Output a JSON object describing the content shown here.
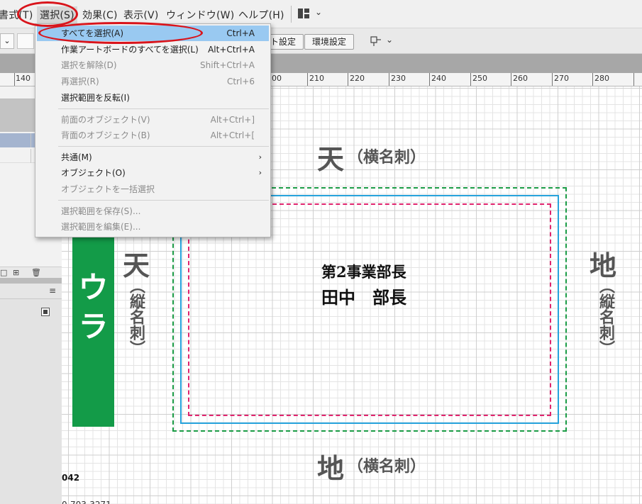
{
  "menubar": {
    "items": [
      "書式(T)",
      "選択(S)",
      "効果(C)",
      "表示(V)",
      "ウィンドウ(W)",
      "ヘルプ(H)"
    ]
  },
  "controlbar": {
    "doc_setup_button": "ト設定",
    "preferences_button": "環境設定"
  },
  "ruler": {
    "labels": [
      "140",
      "00",
      "210",
      "220",
      "230",
      "240",
      "250",
      "260",
      "270",
      "280"
    ]
  },
  "canvas": {
    "top_char": "天",
    "top_label": "（横名刺）",
    "bottom_char": "地",
    "bottom_label": "（横名刺）",
    "left_char": "天",
    "left_label": "（縦名刺）",
    "right_char": "地",
    "right_label": "（縦名刺）",
    "green_bar_text": [
      "ウ",
      "ラ"
    ],
    "card_title": "第2事業部長",
    "card_name": "田中　部長",
    "footer_number": "042",
    "footer_partial": "0-703-3271",
    "colors": {
      "bleed_guide": "#1b9c46",
      "trim_line": "#27a3dc",
      "safe_area": "#e0246e",
      "green_bar": "#139b48"
    }
  },
  "dropdown": {
    "items": [
      {
        "label": "すべてを選択(A)",
        "shortcut": "Ctrl+A",
        "disabled": false,
        "highlight": true
      },
      {
        "label": "作業アートボードのすべてを選択(L)",
        "shortcut": "Alt+Ctrl+A",
        "disabled": false
      },
      {
        "label": "選択を解除(D)",
        "shortcut": "Shift+Ctrl+A",
        "disabled": true
      },
      {
        "label": "再選択(R)",
        "shortcut": "Ctrl+6",
        "disabled": true
      },
      {
        "label": "選択範囲を反転(I)",
        "shortcut": "",
        "disabled": false
      },
      {
        "label": "前面のオブジェクト(V)",
        "shortcut": "Alt+Ctrl+]",
        "disabled": true
      },
      {
        "label": "背面のオブジェクト(B)",
        "shortcut": "Alt+Ctrl+[",
        "disabled": true
      },
      {
        "label": "共通(M)",
        "shortcut": "",
        "disabled": false,
        "submenu": true
      },
      {
        "label": "オブジェクト(O)",
        "shortcut": "",
        "disabled": false,
        "submenu": true
      },
      {
        "label": "オブジェクトを一括選択",
        "shortcut": "",
        "disabled": true
      },
      {
        "label": "選択範囲を保存(S)...",
        "shortcut": "",
        "disabled": true
      },
      {
        "label": "選択範囲を編集(E)...",
        "shortcut": "",
        "disabled": true
      }
    ],
    "submenu_arrow": "›"
  },
  "annotation": {
    "color": "#d9141b"
  }
}
